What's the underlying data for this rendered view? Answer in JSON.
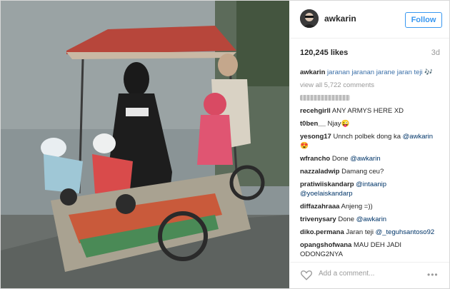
{
  "header": {
    "username": "awkarin",
    "follow_label": "Follow"
  },
  "stats": {
    "likes": "120,245 likes",
    "age": "3d"
  },
  "caption": {
    "user": "awkarin",
    "text": "jaranan jaranan jarane jaran teji 🎶"
  },
  "view_all": "view all 5,722 comments",
  "comments": [
    {
      "user": "recehgirll",
      "text": " ANY ARMYS HERE XD"
    },
    {
      "user": "t0ben__",
      "text": " Njay😜"
    },
    {
      "user": "yesong17",
      "text": " Unnch polbek dong ka ",
      "mention": "@awkarin",
      "tail": " 😍"
    },
    {
      "user": "wfrancho",
      "text": " Done ",
      "mention": "@awkarin",
      "tail": ""
    },
    {
      "user": "nazzaladwip",
      "text": " Damang ceu?",
      "mention": "",
      "tail": ""
    },
    {
      "user": "pratiwiiskandarp",
      "text": " ",
      "mention": "@intaanip @yoelaiskandarp",
      "tail": ""
    },
    {
      "user": "diffazahraaa",
      "text": " Anjeng =))",
      "mention": "",
      "tail": ""
    },
    {
      "user": "trivenysary",
      "text": " Done ",
      "mention": "@awkarin",
      "tail": ""
    },
    {
      "user": "diko.permana",
      "text": " Jaran teji ",
      "mention": "@_teguhsantoso92",
      "tail": ""
    },
    {
      "user": "opangshofwana",
      "text": " MAU DEH JADI ODONG2NYA",
      "mention": "",
      "tail": ""
    }
  ],
  "footer": {
    "add_comment_placeholder": "Add a comment...",
    "more_label": "•••"
  },
  "icons": {
    "heart": "heart-icon",
    "more": "more-options-icon"
  },
  "colors": {
    "follow_blue": "#3897f0",
    "mention_blue": "#003569",
    "muted": "#999999"
  }
}
